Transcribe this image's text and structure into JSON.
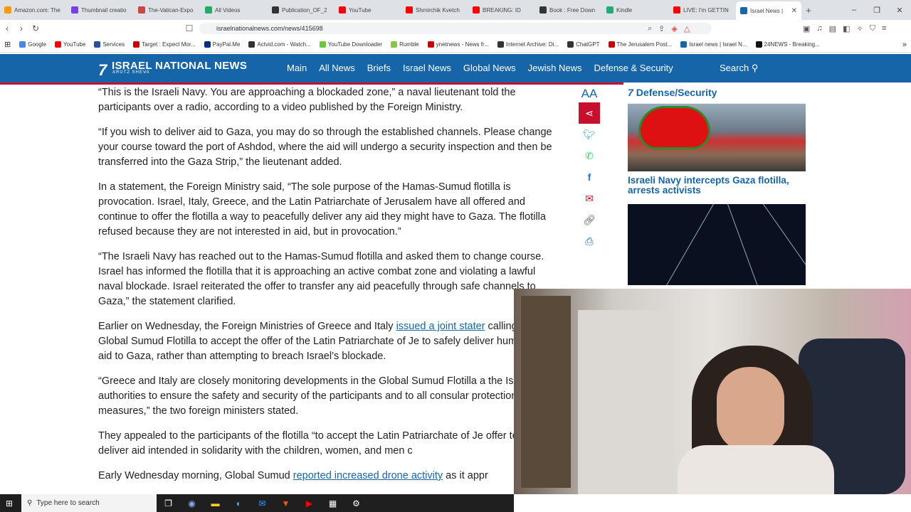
{
  "browser": {
    "tabs": [
      {
        "label": "Amazon.com: The",
        "color": "#ff9900"
      },
      {
        "label": "Thumbnail creatio",
        "color": "#7b3fe4"
      },
      {
        "label": "The-Vatican-Expo",
        "color": "#c44"
      },
      {
        "label": "All Videos",
        "color": "#2a6"
      },
      {
        "label": "Publication_OF_2",
        "color": "#333"
      },
      {
        "label": "YouTube",
        "color": "#f00"
      },
      {
        "label": "Shmirchik Kvetch",
        "color": "#f00"
      },
      {
        "label": "BREAKING: ID",
        "color": "#f00"
      },
      {
        "label": "Book : Free Down",
        "color": "#333"
      },
      {
        "label": "Kindle",
        "color": "#2a7"
      },
      {
        "label": "LIVE: I'm GETTIN",
        "color": "#f00"
      },
      {
        "label": "Israel News |",
        "color": "#1565a8",
        "active": true
      }
    ],
    "new_tab_label": "+",
    "url": "israelnationalnews.com/news/415698",
    "bookmarks": [
      {
        "label": "Google",
        "color": "#4285f4"
      },
      {
        "label": "YouTube",
        "color": "#f00"
      },
      {
        "label": "Services",
        "color": "#2a4fa0"
      },
      {
        "label": "Target : Expect Mor...",
        "color": "#c00"
      },
      {
        "label": "PayPal.Me",
        "color": "#003087"
      },
      {
        "label": "Actvid.com - Watch...",
        "color": "#333"
      },
      {
        "label": "YouTube Downloader",
        "color": "#6c3"
      },
      {
        "label": "Rumble",
        "color": "#85c742"
      },
      {
        "label": "ynetnews - News fr...",
        "color": "#c00"
      },
      {
        "label": "Internet Archive: Di...",
        "color": "#333"
      },
      {
        "label": "ChatGPT",
        "color": "#333"
      },
      {
        "label": "The Jerusalem Post...",
        "color": "#c00"
      },
      {
        "label": "Israel news | Israel N...",
        "color": "#1565a8"
      },
      {
        "label": "24NEWS - Breaking...",
        "color": "#111"
      }
    ],
    "bookmarks_more": "»"
  },
  "site": {
    "logo_text": "ISRAEL NATIONAL NEWS",
    "logo_sub": "ARUTZ SHEVA",
    "nav": [
      "Main",
      "All News",
      "Briefs",
      "Israel News",
      "Global News",
      "Jewish News",
      "Defense & Security"
    ],
    "search_label": "Search",
    "brand_color": "#1565a8",
    "accent_color": "#c8102e"
  },
  "article": {
    "paragraphs": [
      "“This is the Israeli Navy. You are approaching a blockaded zone,” a naval lieutenant told the participants over a radio, according to a video published by the Foreign Ministry.",
      "“If you wish to deliver aid to Gaza, you may do so through the established channels. Please change your course toward the port of Ashdod, where the aid will undergo a security inspection and then be transferred into the Gaza Strip,” the lieutenant added.",
      "In a statement, the Foreign Ministry said, “The sole purpose of the Hamas-Sumud flotilla is provocation. Israel, Italy, Greece, and the Latin Patriarchate of Jerusalem have all offered and continue to offer the flotilla a way to peacefully deliver any aid they might have to Gaza. The flotilla refused because they are not interested in aid, but in provocation.”",
      "“The Israeli Navy has reached out to the Hamas-Sumud flotilla and asked them to change course. Israel has informed the flotilla that it is approaching an active combat zone and violating a lawful naval blockade. Israel reiterated the offer to transfer any aid peacefully through safe channels to Gaza,” the statement clarified."
    ],
    "p5_before": "Earlier on Wednesday, the Foreign Ministries of Greece and Italy ",
    "p5_link": "issued a joint stater",
    "p5_after": " calling on the Global Sumud Flotilla to accept the offer of the Latin Patriarchate of Je to safely deliver humanitarian aid to Gaza, rather than attempting to breach Israel’s blockade.",
    "p6": "“Greece and Italy are closely monitoring developments in the Global Sumud Flotilla a the Israeli authorities to ensure the safety and security of the participants and to all consular protection measures,” the two foreign ministers stated.",
    "p7": "They appealed to the participants of the flotilla “to accept the Latin Patriarchate of Je offer to safely deliver aid intended in solidarity with the children, women, and men c",
    "p8_before": "Early Wednesday morning, Global Sumud ",
    "p8_link": "reported increased drone activity",
    "p8_after": " as it appr"
  },
  "share": {
    "font_size_label": "AA",
    "icons": [
      "share-icon",
      "twitter-icon",
      "whatsapp-icon",
      "facebook-icon",
      "email-icon",
      "link-icon",
      "print-icon"
    ]
  },
  "sidebar": {
    "section_title": "Defense/Security",
    "story_title": "Israeli Navy intercepts Gaza flotilla, arrests activists"
  },
  "taskbar": {
    "search_placeholder": "Type here to search"
  }
}
